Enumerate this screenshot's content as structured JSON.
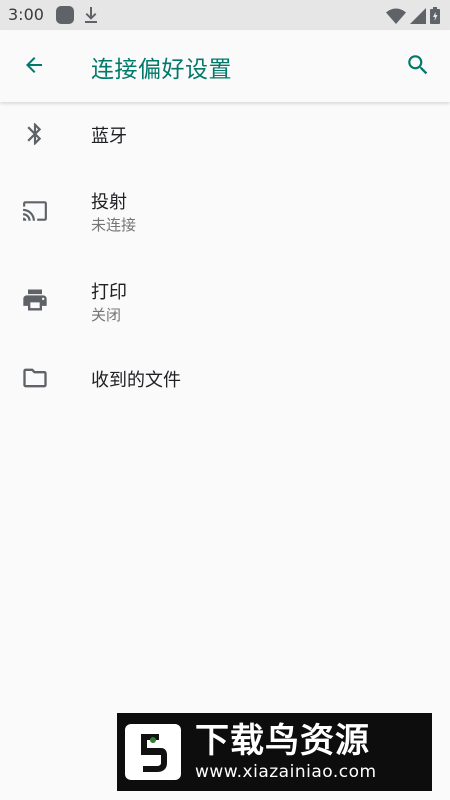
{
  "status_bar": {
    "time": "3:00",
    "icons": [
      "app-notification-icon",
      "download-icon",
      "wifi-icon",
      "signal-icon",
      "battery-icon"
    ]
  },
  "app_bar": {
    "title": "连接偏好设置",
    "accent_color": "#00796b",
    "back_icon": "arrow-back-icon",
    "search_icon": "search-icon"
  },
  "items": [
    {
      "icon": "bluetooth-icon",
      "title": "蓝牙",
      "subtitle": ""
    },
    {
      "icon": "cast-icon",
      "title": "投射",
      "subtitle": "未连接"
    },
    {
      "icon": "print-icon",
      "title": "打印",
      "subtitle": "关闭"
    },
    {
      "icon": "folder-icon",
      "title": "收到的文件",
      "subtitle": ""
    }
  ],
  "watermark": {
    "title": "下载鸟资源",
    "url": "www.xiazainiao.com"
  }
}
